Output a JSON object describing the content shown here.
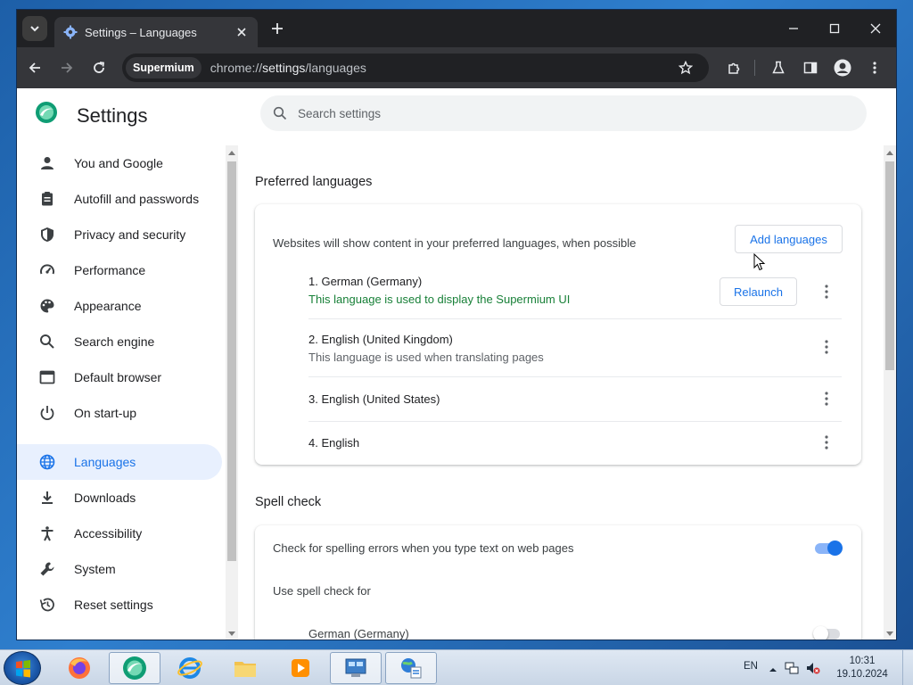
{
  "browser": {
    "tab_title": "Settings – Languages",
    "site_chip": "Supermium",
    "url_scheme": "chrome://",
    "url_host": "settings",
    "url_path": "/languages"
  },
  "page": {
    "title": "Settings",
    "search_placeholder": "Search settings"
  },
  "sidebar": {
    "items": [
      {
        "label": "You and Google",
        "icon": "person-icon"
      },
      {
        "label": "Autofill and passwords",
        "icon": "clipboard-icon"
      },
      {
        "label": "Privacy and security",
        "icon": "shield-icon"
      },
      {
        "label": "Performance",
        "icon": "speedometer-icon"
      },
      {
        "label": "Appearance",
        "icon": "palette-icon"
      },
      {
        "label": "Search engine",
        "icon": "search-icon"
      },
      {
        "label": "Default browser",
        "icon": "browser-window-icon"
      },
      {
        "label": "On start-up",
        "icon": "power-icon"
      },
      {
        "label": "Languages",
        "icon": "globe-icon",
        "active": true
      },
      {
        "label": "Downloads",
        "icon": "download-icon"
      },
      {
        "label": "Accessibility",
        "icon": "accessibility-icon"
      },
      {
        "label": "System",
        "icon": "wrench-icon"
      },
      {
        "label": "Reset settings",
        "icon": "history-icon"
      }
    ]
  },
  "preferred_languages": {
    "heading": "Preferred languages",
    "description": "Websites will show content in your preferred languages, when possible",
    "add_button": "Add languages",
    "relaunch_button": "Relaunch",
    "languages": [
      {
        "name": "1. German (Germany)",
        "note": "This language is used to display the Supermium UI"
      },
      {
        "name": "2. English (United Kingdom)",
        "note": "This language is used when translating pages"
      },
      {
        "name": "3. English (United States)",
        "note": ""
      },
      {
        "name": "4. English",
        "note": ""
      }
    ]
  },
  "spell_check": {
    "heading": "Spell check",
    "check_label": "Check for spelling errors when you type text on web pages",
    "check_enabled": true,
    "use_for_label": "Use spell check for",
    "languages": [
      {
        "name": "German (Germany)",
        "enabled": false
      }
    ]
  },
  "colors": {
    "accent": "#1a73e8",
    "note_green": "#188038",
    "note_grey": "#5f6368"
  },
  "taskbar": {
    "language": "EN",
    "time": "10:31",
    "date": "19.10.2024"
  }
}
